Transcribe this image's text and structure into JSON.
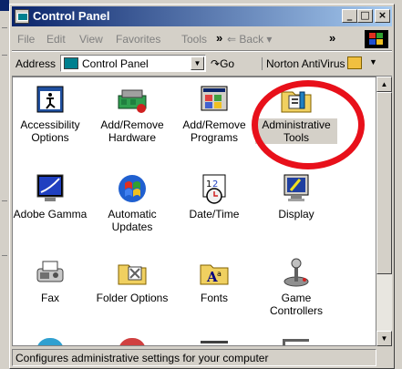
{
  "window": {
    "title": "Control Panel",
    "minimize": "_",
    "maximize": "□",
    "close": "×"
  },
  "menu": {
    "items": [
      "File",
      "Edit",
      "View",
      "Favorites",
      "Tools"
    ],
    "chevron": "»",
    "back": "⇐ Back ▾",
    "chevron2": "»"
  },
  "address": {
    "label": "Address",
    "value": "Control Panel",
    "go": "Go",
    "toolbar_name": "Norton AntiVirus"
  },
  "items": [
    {
      "label": "Accessibility Options",
      "icon": "accessibility-icon"
    },
    {
      "label": "Add/Remove Hardware",
      "icon": "hardware-icon"
    },
    {
      "label": "Add/Remove Programs",
      "icon": "programs-icon"
    },
    {
      "label": "Administrative Tools",
      "icon": "admin-tools-icon",
      "selected": true
    },
    {
      "label": "Adobe Gamma",
      "icon": "adobe-gamma-icon"
    },
    {
      "label": "Automatic Updates",
      "icon": "automatic-updates-icon"
    },
    {
      "label": "Date/Time",
      "icon": "calendar-clock-icon"
    },
    {
      "label": "Display",
      "icon": "display-icon"
    },
    {
      "label": "Fax",
      "icon": "fax-icon"
    },
    {
      "label": "Folder Options",
      "icon": "folder-options-icon"
    },
    {
      "label": "Fonts",
      "icon": "fonts-icon"
    },
    {
      "label": "Game Controllers",
      "icon": "joystick-icon"
    }
  ],
  "status": {
    "text": "Configures administrative settings for your computer"
  },
  "colors": {
    "titlebar_start": "#0a246a",
    "titlebar_end": "#a6caf0",
    "highlight_ring": "#e8101a",
    "face": "#d4d0c8"
  }
}
